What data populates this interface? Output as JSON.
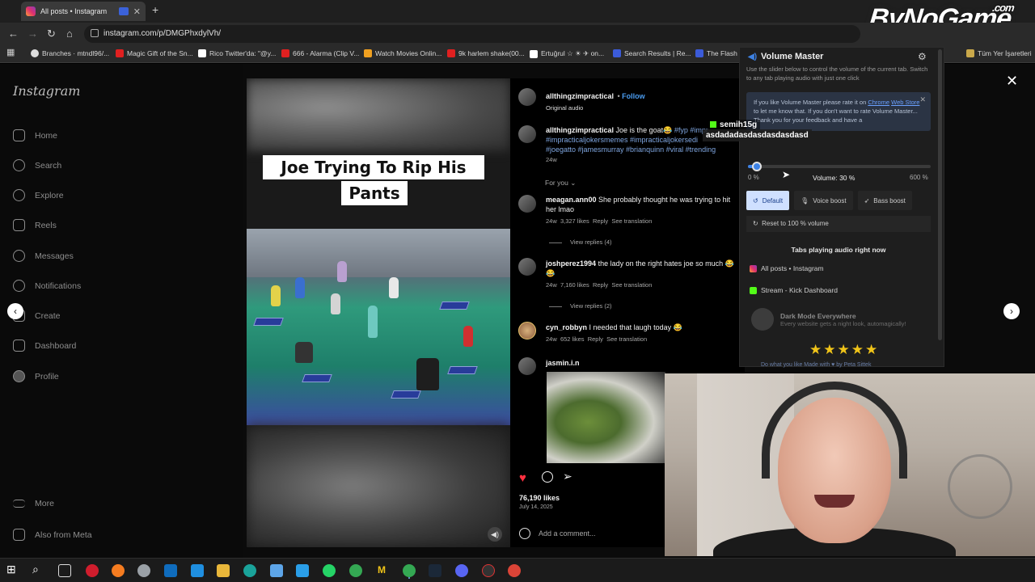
{
  "browser": {
    "tab_title": "All posts • Instagram",
    "url": "instagram.com/p/DMGPhxdylVh/",
    "bookmarks": [
      "Branches · mtndl96/...",
      "Magic Gift of the Sn...",
      "Rico Twitter'da: \"@y...",
      "666 - Alarma (Clip V...",
      "Watch Movies Onlin...",
      "9k harlem shake(00...",
      "Ertuğrul ☆ ☀ ✈ on...",
      "Search Results | Re...",
      "The Flash vi..."
    ],
    "all_bookmarks": "Tüm Yer İşaretleri"
  },
  "watermark": {
    "main": "ByNoGame",
    "suffix": ".com"
  },
  "instagram": {
    "logo": "Instagram",
    "nav": [
      "Home",
      "Search",
      "Explore",
      "Reels",
      "Messages",
      "Notifications",
      "Create",
      "Dashboard",
      "Profile",
      "More",
      "Also from Meta"
    ]
  },
  "post": {
    "caption_line1": "Joe Trying To Rip His",
    "caption_line2": "Pants",
    "author": "allthingzimpractical",
    "follow": "Follow",
    "audio": "Original audio",
    "desc_user": "allthingzimpractical",
    "desc_text": "Joe is the goat😂",
    "desc_tags_1": "#fyp #impr",
    "desc_tags_2": "#impracticaljokersmemes #impracticaljokersedi",
    "desc_tags_3": "#joegatto #jamesmurray #brianquinn #viral #trending",
    "desc_age": "24w",
    "for_you": "For you",
    "comments": [
      {
        "user": "meagan.ann00",
        "text": "She probably thought he was trying to hit her lmao",
        "age": "24w",
        "likes": "3,327 likes",
        "reply": "Reply",
        "translate": "See translation",
        "replies": "View replies (4)"
      },
      {
        "user": "joshperez1994",
        "text": "the lady on the right hates joe so much 😂😂",
        "age": "24w",
        "likes": "7,160 likes",
        "reply": "Reply",
        "translate": "See translation",
        "replies": "View replies (2)"
      },
      {
        "user": "cyn_robbyn",
        "text": "I needed that laugh today 😂",
        "age": "24w",
        "likes": "652 likes",
        "reply": "Reply",
        "translate": "See translation"
      },
      {
        "user": "jasmin.i.n",
        "text": ""
      }
    ],
    "likes": "76,190 likes",
    "date": "July 14, 2025",
    "add_comment": "Add a comment..."
  },
  "volume_master": {
    "title": "Volume Master",
    "description": "Use the slider below to control the volume of the current tab. Switch to any tab playing audio with just one click",
    "rate_text_1": "If you like Volume Master please rate it on",
    "rate_link_1": "Chrome",
    "rate_link_2": "Web Store",
    "rate_text_2": "to let me know that. If you don't want to",
    "rate_text_3": "rate Volume Master... Thank you for your feedback and have a",
    "min_label": "0 %",
    "max_label": "600 %",
    "volume_label": "Volume: 30 %",
    "volume_fraction": 0.05,
    "modes": [
      "Default",
      "Voice boost",
      "Bass boost"
    ],
    "reset": "Reset to 100 % volume",
    "tabs_heading": "Tabs playing audio right now",
    "playing_tabs": [
      "All posts • Instagram",
      "Stream - Kick Dashboard"
    ],
    "dark_title": "Dark Mode Everywhere",
    "dark_sub": "Every website gets a night look, automagically!",
    "stars": "★★★★★",
    "footer": "Do what you like     Made with ♥ by Peta Sittek"
  },
  "chat": {
    "user": "semih15g",
    "message": "asdadadasdasdasdasdasd"
  },
  "colors": {
    "accent": "#3d82e5",
    "like": "#ff3040",
    "link": "#7fa6e0"
  }
}
